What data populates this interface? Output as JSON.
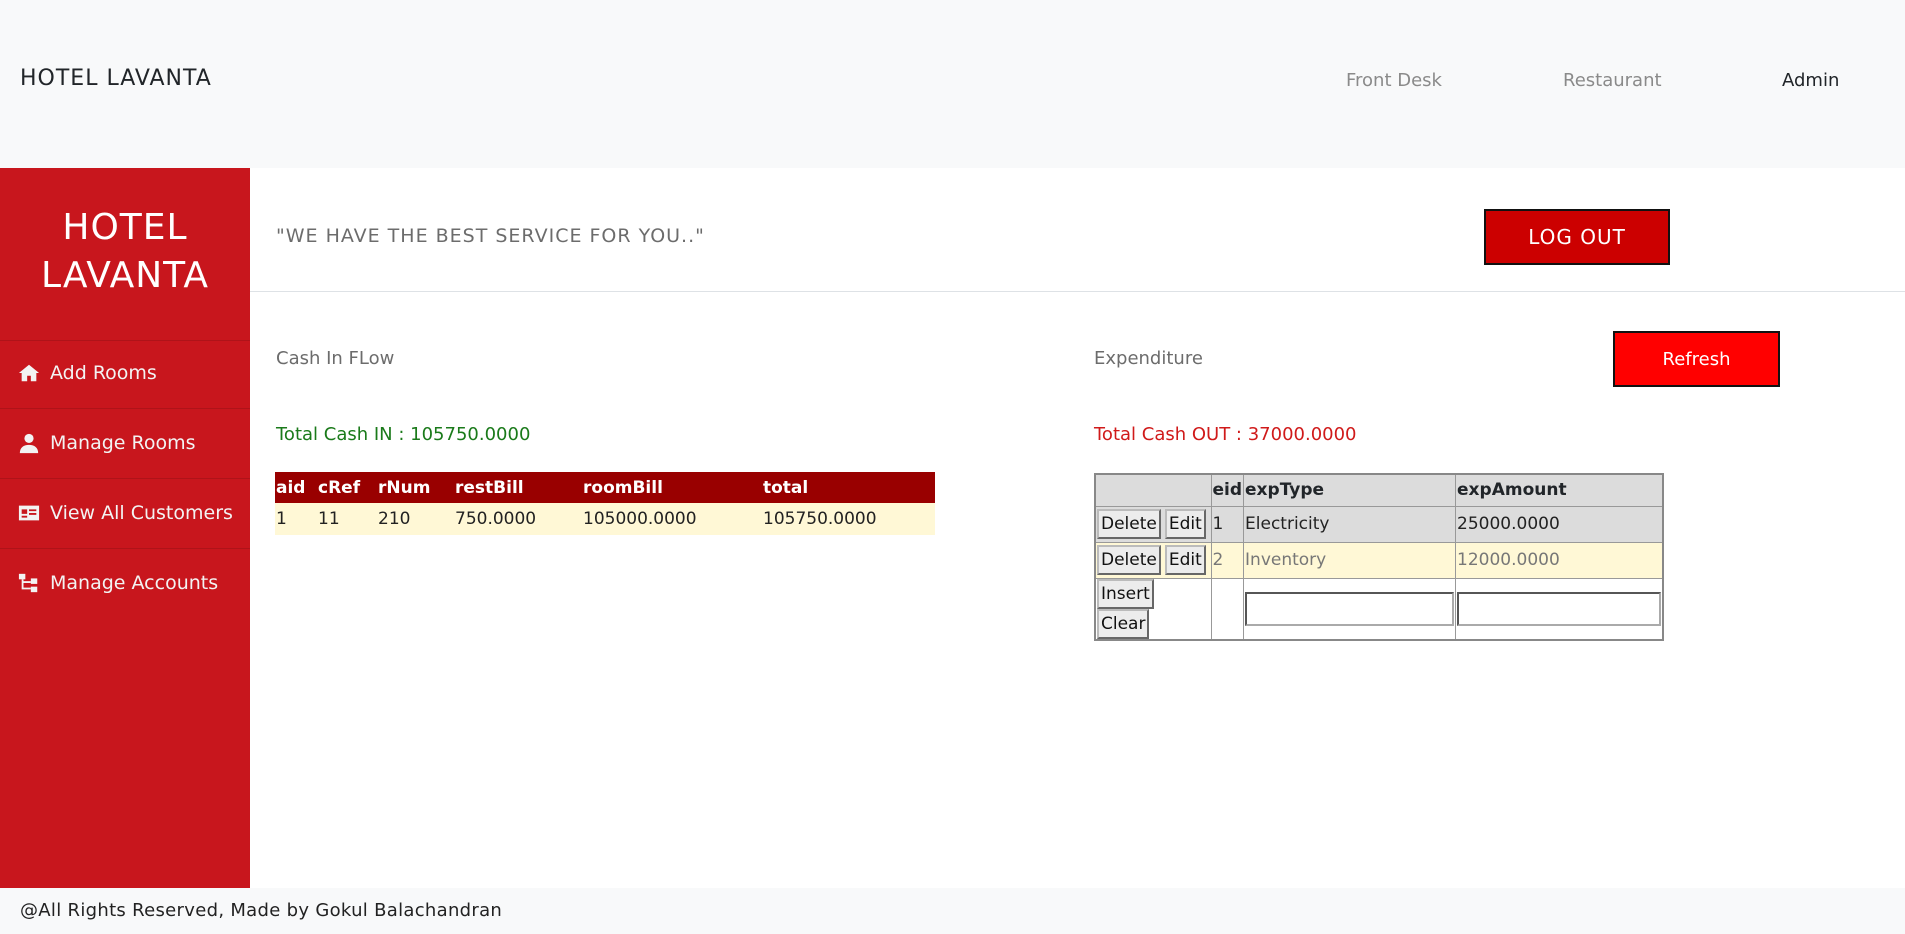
{
  "topnav": {
    "brand": "HOTEL LAVANTA",
    "links": [
      "Front Desk",
      "Restaurant",
      "Admin"
    ]
  },
  "sidebar": {
    "brand_line1": "HOTEL",
    "brand_line2": "LAVANTA",
    "items": [
      {
        "label": "Add Rooms",
        "icon": "home-icon"
      },
      {
        "label": "Manage Rooms",
        "icon": "user-icon"
      },
      {
        "label": "View All Customers",
        "icon": "id-card-icon"
      },
      {
        "label": "Manage Accounts",
        "icon": "sitemap-icon"
      }
    ]
  },
  "header": {
    "tagline": "\"WE HAVE THE BEST SERVICE FOR YOU..\"",
    "logout_label": "LOG OUT"
  },
  "cash": {
    "label": "Cash In FLow",
    "total": "Total Cash IN : 105750.0000",
    "columns": [
      "aid",
      "cRef",
      "rNum",
      "restBill",
      "roomBill",
      "total"
    ],
    "rows": [
      [
        "1",
        "11",
        "210",
        "750.0000",
        "105000.0000",
        "105750.0000"
      ]
    ]
  },
  "expenditure": {
    "label": "Expenditure",
    "refresh_label": "Refresh",
    "total": "Total Cash OUT : 37000.0000",
    "columns": [
      "",
      "eid",
      "expType",
      "expAmount"
    ],
    "rows": [
      {
        "delete": "Delete",
        "edit": "Edit",
        "eid": "1",
        "expType": "Electricity",
        "expAmount": "25000.0000"
      },
      {
        "delete": "Delete",
        "edit": "Edit",
        "eid": "2",
        "expType": "Inventory",
        "expAmount": "12000.0000"
      }
    ],
    "insert_label": "Insert",
    "clear_label": "Clear"
  },
  "footer": {
    "text": "@All Rights Reserved, Made by Gokul Balachandran"
  },
  "colors": {
    "sidebar": "#c8161d",
    "logout": "#cc0000",
    "refresh": "#ff0000",
    "table_header": "#990000",
    "row_highlight": "#fff8d6",
    "cash_in_text": "#1a7a1a",
    "cash_out_text": "#d01a1a"
  }
}
